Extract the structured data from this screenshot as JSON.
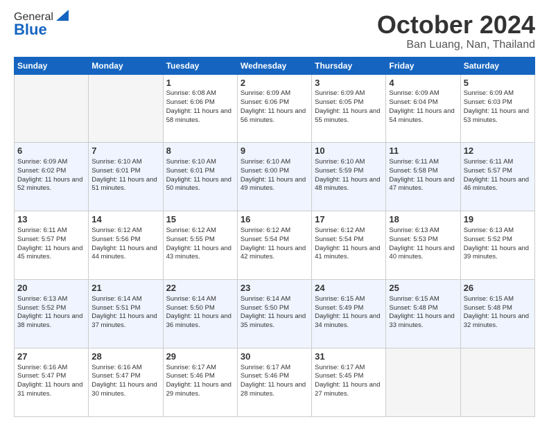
{
  "logo": {
    "general": "General",
    "blue": "Blue"
  },
  "header": {
    "month": "October 2024",
    "location": "Ban Luang, Nan, Thailand"
  },
  "days_of_week": [
    "Sunday",
    "Monday",
    "Tuesday",
    "Wednesday",
    "Thursday",
    "Friday",
    "Saturday"
  ],
  "weeks": [
    [
      {
        "day": "",
        "empty": true
      },
      {
        "day": "",
        "empty": true
      },
      {
        "day": "1",
        "sunrise": "6:08 AM",
        "sunset": "6:06 PM",
        "daylight": "11 hours and 58 minutes."
      },
      {
        "day": "2",
        "sunrise": "6:09 AM",
        "sunset": "6:06 PM",
        "daylight": "11 hours and 56 minutes."
      },
      {
        "day": "3",
        "sunrise": "6:09 AM",
        "sunset": "6:05 PM",
        "daylight": "11 hours and 55 minutes."
      },
      {
        "day": "4",
        "sunrise": "6:09 AM",
        "sunset": "6:04 PM",
        "daylight": "11 hours and 54 minutes."
      },
      {
        "day": "5",
        "sunrise": "6:09 AM",
        "sunset": "6:03 PM",
        "daylight": "11 hours and 53 minutes."
      }
    ],
    [
      {
        "day": "6",
        "sunrise": "6:09 AM",
        "sunset": "6:02 PM",
        "daylight": "11 hours and 52 minutes."
      },
      {
        "day": "7",
        "sunrise": "6:10 AM",
        "sunset": "6:01 PM",
        "daylight": "11 hours and 51 minutes."
      },
      {
        "day": "8",
        "sunrise": "6:10 AM",
        "sunset": "6:01 PM",
        "daylight": "11 hours and 50 minutes."
      },
      {
        "day": "9",
        "sunrise": "6:10 AM",
        "sunset": "6:00 PM",
        "daylight": "11 hours and 49 minutes."
      },
      {
        "day": "10",
        "sunrise": "6:10 AM",
        "sunset": "5:59 PM",
        "daylight": "11 hours and 48 minutes."
      },
      {
        "day": "11",
        "sunrise": "6:11 AM",
        "sunset": "5:58 PM",
        "daylight": "11 hours and 47 minutes."
      },
      {
        "day": "12",
        "sunrise": "6:11 AM",
        "sunset": "5:57 PM",
        "daylight": "11 hours and 46 minutes."
      }
    ],
    [
      {
        "day": "13",
        "sunrise": "6:11 AM",
        "sunset": "5:57 PM",
        "daylight": "11 hours and 45 minutes."
      },
      {
        "day": "14",
        "sunrise": "6:12 AM",
        "sunset": "5:56 PM",
        "daylight": "11 hours and 44 minutes."
      },
      {
        "day": "15",
        "sunrise": "6:12 AM",
        "sunset": "5:55 PM",
        "daylight": "11 hours and 43 minutes."
      },
      {
        "day": "16",
        "sunrise": "6:12 AM",
        "sunset": "5:54 PM",
        "daylight": "11 hours and 42 minutes."
      },
      {
        "day": "17",
        "sunrise": "6:12 AM",
        "sunset": "5:54 PM",
        "daylight": "11 hours and 41 minutes."
      },
      {
        "day": "18",
        "sunrise": "6:13 AM",
        "sunset": "5:53 PM",
        "daylight": "11 hours and 40 minutes."
      },
      {
        "day": "19",
        "sunrise": "6:13 AM",
        "sunset": "5:52 PM",
        "daylight": "11 hours and 39 minutes."
      }
    ],
    [
      {
        "day": "20",
        "sunrise": "6:13 AM",
        "sunset": "5:52 PM",
        "daylight": "11 hours and 38 minutes."
      },
      {
        "day": "21",
        "sunrise": "6:14 AM",
        "sunset": "5:51 PM",
        "daylight": "11 hours and 37 minutes."
      },
      {
        "day": "22",
        "sunrise": "6:14 AM",
        "sunset": "5:50 PM",
        "daylight": "11 hours and 36 minutes."
      },
      {
        "day": "23",
        "sunrise": "6:14 AM",
        "sunset": "5:50 PM",
        "daylight": "11 hours and 35 minutes."
      },
      {
        "day": "24",
        "sunrise": "6:15 AM",
        "sunset": "5:49 PM",
        "daylight": "11 hours and 34 minutes."
      },
      {
        "day": "25",
        "sunrise": "6:15 AM",
        "sunset": "5:48 PM",
        "daylight": "11 hours and 33 minutes."
      },
      {
        "day": "26",
        "sunrise": "6:15 AM",
        "sunset": "5:48 PM",
        "daylight": "11 hours and 32 minutes."
      }
    ],
    [
      {
        "day": "27",
        "sunrise": "6:16 AM",
        "sunset": "5:47 PM",
        "daylight": "11 hours and 31 minutes."
      },
      {
        "day": "28",
        "sunrise": "6:16 AM",
        "sunset": "5:47 PM",
        "daylight": "11 hours and 30 minutes."
      },
      {
        "day": "29",
        "sunrise": "6:17 AM",
        "sunset": "5:46 PM",
        "daylight": "11 hours and 29 minutes."
      },
      {
        "day": "30",
        "sunrise": "6:17 AM",
        "sunset": "5:46 PM",
        "daylight": "11 hours and 28 minutes."
      },
      {
        "day": "31",
        "sunrise": "6:17 AM",
        "sunset": "5:45 PM",
        "daylight": "11 hours and 27 minutes."
      },
      {
        "day": "",
        "empty": true
      },
      {
        "day": "",
        "empty": true
      }
    ]
  ]
}
